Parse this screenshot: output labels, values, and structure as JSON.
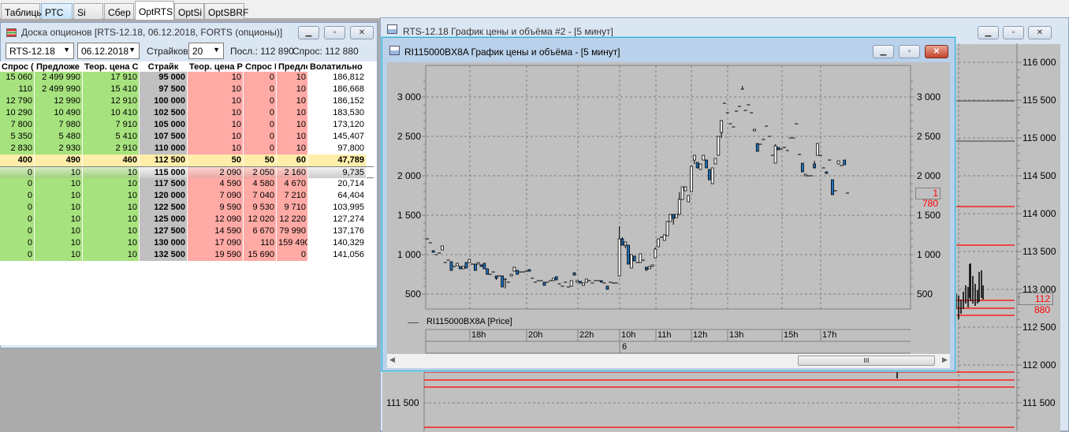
{
  "tabs": [
    "Таблицы",
    "РТС",
    "Si",
    "Сбер",
    "OptRTS",
    "OptSi",
    "OptSBRF"
  ],
  "active_tab": "OptRTS",
  "options_board": {
    "title": "Доска опционов [RTS-12.18, 06.12.2018, FORTS (опционы)]",
    "underlying": "RTS-12.18",
    "expiry": "06.12.2018",
    "strikes_label": "Страйков:",
    "strikes_value": "20",
    "last_label": "Посл.: 112 890",
    "bid_label": "Спрос: 112 880",
    "columns": [
      "Спрос (",
      "Предложе",
      "Теор. цена С",
      "Страйк",
      "Теор. цена Р",
      "Спрос Р",
      "Предло",
      "Волатильно"
    ],
    "rows": [
      [
        "15 060",
        "2 499 990",
        "17 910",
        "95 000",
        "10",
        "0",
        "10",
        "186,812"
      ],
      [
        "110",
        "2 499 990",
        "15 410",
        "97 500",
        "10",
        "0",
        "10",
        "186,668"
      ],
      [
        "12 790",
        "12 990",
        "12 910",
        "100 000",
        "10",
        "0",
        "10",
        "186,152"
      ],
      [
        "10 290",
        "10 490",
        "10 410",
        "102 500",
        "10",
        "0",
        "10",
        "183,530"
      ],
      [
        "7 800",
        "7 980",
        "7 910",
        "105 000",
        "10",
        "0",
        "10",
        "173,120"
      ],
      [
        "5 350",
        "5 480",
        "5 410",
        "107 500",
        "10",
        "0",
        "10",
        "145,407"
      ],
      [
        "2 830",
        "2 930",
        "2 910",
        "110 000",
        "10",
        "0",
        "10",
        "97,800"
      ],
      [
        "400",
        "490",
        "460",
        "112 500",
        "50",
        "50",
        "60",
        "47,789"
      ],
      [
        "0",
        "10",
        "10",
        "115 000",
        "2 090",
        "2 050",
        "2 160",
        "9,735"
      ],
      [
        "0",
        "10",
        "10",
        "117 500",
        "4 590",
        "4 580",
        "4 670",
        "20,714"
      ],
      [
        "0",
        "10",
        "10",
        "120 000",
        "7 090",
        "7 040",
        "7 210",
        "64,404"
      ],
      [
        "0",
        "10",
        "10",
        "122 500",
        "9 590",
        "9 530",
        "9 710",
        "103,995"
      ],
      [
        "0",
        "10",
        "10",
        "125 000",
        "12 090",
        "12 020",
        "12 220",
        "127,274"
      ],
      [
        "0",
        "10",
        "10",
        "127 500",
        "14 590",
        "6 670",
        "79 990",
        "137,176"
      ],
      [
        "0",
        "10",
        "10",
        "130 000",
        "17 090",
        "110",
        "159 490",
        "140,329"
      ],
      [
        "0",
        "10",
        "10",
        "132 500",
        "19 590",
        "15 690",
        "0",
        "141,056"
      ]
    ],
    "atm_row": 7,
    "current_row": 8,
    "colors": {
      "call": "#a6e27e",
      "strike": "#c0c0c0",
      "put": "#ffaaa5",
      "atm": "#ffeeaa"
    }
  },
  "back_chart": {
    "title": "RTS-12.18 График цены и объёма #2 - [5 минут]",
    "y_ticks": [
      "116 000",
      "115 500",
      "115 000",
      "114 500",
      "114 000",
      "113 500",
      "113 000",
      "112 500",
      "112 000",
      "111 500"
    ],
    "last_price_tag": "112 880",
    "last_price_color": "#ff0000"
  },
  "front_chart": {
    "title": "RI115000BX8A График цены и объёма - [5 минут]",
    "legend": "RI115000BX8A [Price]",
    "time_labels": [
      "18h",
      "20h",
      "22h",
      "10h",
      "11h",
      "12h",
      "13h",
      "15h",
      "17h"
    ],
    "day_label": "6",
    "scroll_grip": "III"
  },
  "chart_data": {
    "type": "candlestick",
    "y_ticks": [
      3000,
      2500,
      2000,
      1500,
      1000,
      500
    ],
    "y_tick_labels": [
      "3 000",
      "2 500",
      "2 000",
      "1 500",
      "1 000",
      "500"
    ],
    "ylim": [
      430,
      3290
    ],
    "grid": true,
    "last_price": "1 780",
    "up_color": "#ffffff",
    "down_color": "#1e73be",
    "candles_ohlc": [
      [
        1200,
        1200,
        1200,
        1200
      ],
      [
        1150,
        1150,
        1150,
        1150
      ],
      [
        1050,
        1050,
        1040,
        1040
      ],
      [
        1000,
        1000,
        1000,
        1000
      ],
      [
        1020,
        1020,
        1020,
        1020
      ],
      [
        1060,
        1110,
        1060,
        1110
      ],
      [
        900,
        900,
        900,
        900
      ],
      [
        930,
        930,
        930,
        930
      ],
      [
        910,
        910,
        800,
        800
      ],
      [
        850,
        850,
        850,
        850
      ],
      [
        860,
        890,
        860,
        890
      ],
      [
        850,
        850,
        820,
        820
      ],
      [
        820,
        850,
        820,
        850
      ],
      [
        900,
        900,
        830,
        830
      ],
      [
        900,
        940,
        900,
        940
      ],
      [
        880,
        880,
        880,
        880
      ],
      [
        880,
        880,
        800,
        800
      ],
      [
        880,
        900,
        880,
        900
      ],
      [
        870,
        870,
        850,
        850
      ],
      [
        890,
        890,
        820,
        820
      ],
      [
        820,
        820,
        750,
        750
      ],
      [
        750,
        750,
        750,
        750
      ],
      [
        780,
        780,
        780,
        780
      ],
      [
        730,
        730,
        680,
        700
      ],
      [
        730,
        730,
        730,
        730
      ],
      [
        730,
        730,
        590,
        590
      ],
      [
        690,
        690,
        570,
        690
      ],
      [
        650,
        650,
        650,
        650
      ],
      [
        730,
        750,
        730,
        750
      ],
      [
        790,
        840,
        790,
        840
      ],
      [
        800,
        800,
        750,
        750
      ],
      [
        780,
        780,
        780,
        780
      ],
      [
        780,
        780,
        780,
        780
      ],
      [
        790,
        790,
        790,
        790
      ],
      [
        810,
        810,
        800,
        800
      ],
      [
        700,
        700,
        700,
        700
      ],
      [
        650,
        650,
        650,
        650
      ],
      [
        670,
        670,
        670,
        670
      ],
      [
        670,
        670,
        670,
        670
      ],
      [
        650,
        650,
        610,
        610
      ],
      [
        650,
        650,
        650,
        650
      ],
      [
        670,
        670,
        670,
        670
      ],
      [
        670,
        700,
        670,
        700
      ],
      [
        720,
        720,
        680,
        680
      ],
      [
        630,
        630,
        630,
        630
      ],
      [
        600,
        600,
        600,
        600
      ],
      [
        650,
        650,
        650,
        650
      ],
      [
        590,
        590,
        590,
        590
      ],
      [
        600,
        670,
        600,
        670
      ],
      [
        770,
        770,
        740,
        740
      ],
      [
        650,
        670,
        650,
        670
      ],
      [
        660,
        660,
        650,
        650
      ],
      [
        610,
        640,
        610,
        640
      ],
      [
        650,
        690,
        650,
        690
      ],
      [
        670,
        670,
        670,
        670
      ],
      [
        640,
        640,
        640,
        640
      ],
      [
        670,
        670,
        670,
        670
      ],
      [
        670,
        670,
        670,
        670
      ],
      [
        670,
        670,
        650,
        650
      ],
      [
        640,
        640,
        640,
        640
      ],
      [
        600,
        600,
        560,
        560
      ],
      [
        650,
        650,
        650,
        650
      ],
      [
        640,
        640,
        640,
        640
      ],
      [
        640,
        640,
        640,
        640
      ],
      [
        730,
        1360,
        730,
        1200
      ],
      [
        1200,
        1220,
        1120,
        1120
      ],
      [
        1120,
        1160,
        1080,
        1160
      ],
      [
        1120,
        1120,
        880,
        880
      ],
      [
        830,
        1000,
        830,
        1000
      ],
      [
        980,
        980,
        920,
        920
      ],
      [
        900,
        900,
        900,
        900
      ],
      [
        900,
        1010,
        900,
        1010
      ],
      [
        930,
        930,
        930,
        930
      ],
      [
        840,
        840,
        790,
        810
      ],
      [
        820,
        850,
        820,
        850
      ],
      [
        850,
        870,
        850,
        870
      ],
      [
        960,
        1090,
        960,
        1070
      ],
      [
        1100,
        1200,
        1100,
        1200
      ],
      [
        1220,
        1230,
        1220,
        1220
      ],
      [
        1180,
        1250,
        1180,
        1250
      ],
      [
        1240,
        1420,
        1240,
        1420
      ],
      [
        1420,
        1510,
        1420,
        1510
      ],
      [
        1510,
        1510,
        1380,
        1460
      ],
      [
        1470,
        1510,
        1470,
        1510
      ],
      [
        1510,
        1790,
        1510,
        1700
      ],
      [
        1700,
        1860,
        1700,
        1860
      ],
      [
        1810,
        1860,
        1810,
        1860
      ],
      [
        1670,
        1750,
        1670,
        1750
      ],
      [
        1800,
        2120,
        1800,
        2120
      ],
      [
        2200,
        2260,
        2150,
        2260
      ],
      [
        2170,
        2170,
        2100,
        2100
      ],
      [
        2080,
        2150,
        2080,
        2150
      ],
      [
        2200,
        2260,
        2200,
        2260
      ],
      [
        2200,
        2200,
        2100,
        2100
      ],
      [
        2080,
        2080,
        1950,
        1950
      ],
      [
        1900,
        2100,
        1900,
        2100
      ],
      [
        2150,
        2220,
        2150,
        2220
      ],
      [
        2260,
        2500,
        2260,
        2500
      ],
      [
        2550,
        2700,
        2480,
        2700
      ],
      [
        2920,
        2920,
        2920,
        2920
      ],
      [
        2800,
        2800,
        2800,
        2800
      ],
      [
        2660,
        2660,
        2660,
        2660
      ],
      [
        2620,
        2620,
        2620,
        2620
      ],
      [
        2820,
        2820,
        2820,
        2820
      ],
      [
        2880,
        2880,
        2880,
        2880
      ],
      [
        3100,
        3140,
        3100,
        3100
      ],
      [
        2830,
        2830,
        2830,
        2830
      ],
      [
        2900,
        2900,
        2900,
        2900
      ],
      [
        2800,
        2800,
        2800,
        2800
      ],
      [
        2570,
        2590,
        2570,
        2590
      ],
      [
        2410,
        2410,
        2310,
        2310
      ],
      [
        2400,
        2400,
        2400,
        2400
      ],
      [
        2460,
        2460,
        2460,
        2460
      ],
      [
        2630,
        2630,
        2630,
        2630
      ],
      [
        2500,
        2500,
        2500,
        2500
      ],
      [
        2260,
        2260,
        2260,
        2260
      ],
      [
        2160,
        2400,
        2160,
        2380
      ],
      [
        2360,
        2360,
        2330,
        2330
      ],
      [
        2340,
        2340,
        2340,
        2340
      ],
      [
        2360,
        2360,
        2360,
        2360
      ],
      [
        2320,
        2320,
        2320,
        2320
      ],
      [
        2480,
        2480,
        2480,
        2480
      ],
      [
        2480,
        2480,
        2480,
        2480
      ],
      [
        2660,
        2660,
        2660,
        2660
      ],
      [
        2270,
        2270,
        2270,
        2270
      ],
      [
        2160,
        2160,
        2050,
        2050
      ],
      [
        2000,
        2020,
        2000,
        2020
      ],
      [
        2000,
        2000,
        2000,
        2000
      ],
      [
        2000,
        2000,
        2000,
        2000
      ],
      [
        2150,
        2190,
        2100,
        2100
      ],
      [
        2260,
        2410,
        2260,
        2410
      ],
      [
        2260,
        2260,
        2260,
        2260
      ],
      [
        2100,
        2100,
        2100,
        2100
      ],
      [
        2050,
        2050,
        2030,
        2030
      ],
      [
        2200,
        2200,
        2200,
        2200
      ],
      [
        1950,
        1950,
        1760,
        1760
      ],
      [
        1810,
        1810,
        1810,
        1810
      ],
      [
        2150,
        2190,
        2150,
        2190
      ],
      [
        2130,
        2130,
        2130,
        2130
      ],
      [
        2200,
        2200,
        2140,
        2140
      ],
      [
        1780,
        1780,
        1780,
        1780
      ]
    ]
  }
}
